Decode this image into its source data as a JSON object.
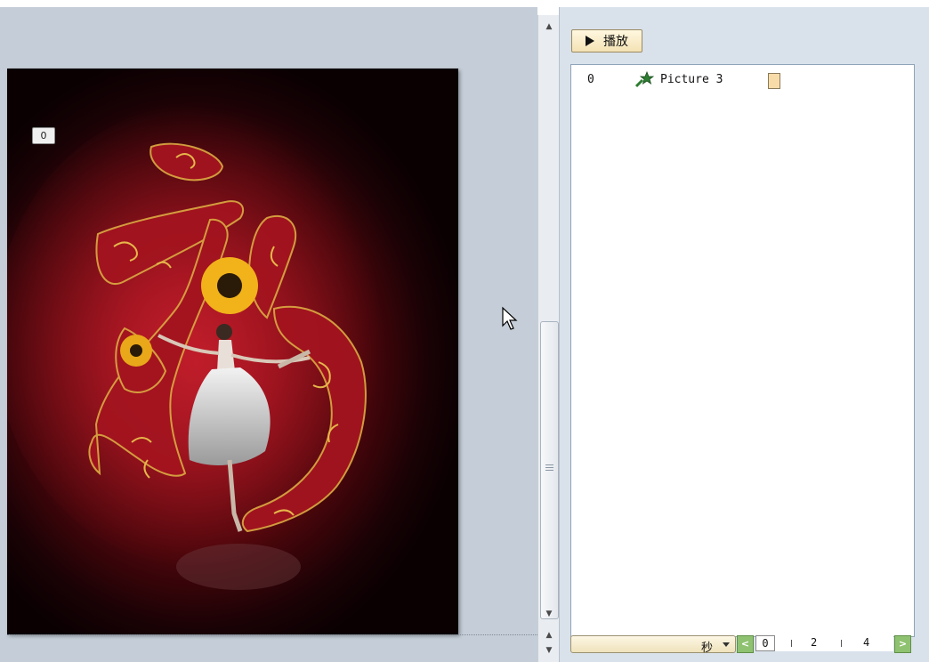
{
  "editor": {
    "animation_tag": "0"
  },
  "pane": {
    "play_button_label": "播放",
    "animation_items": [
      {
        "index": "0",
        "name": "Picture 3",
        "effect_icon": "star-effect-icon"
      }
    ],
    "timeline": {
      "unit_label": "秒",
      "zero_label": "0",
      "tick_labels": [
        "2",
        "4"
      ]
    }
  },
  "colors": {
    "slide_background": "#8a0f18",
    "timing_bar": "#f7dcaa",
    "nav_buttons": "#8fc270",
    "play_button": "#f4e2b4"
  }
}
